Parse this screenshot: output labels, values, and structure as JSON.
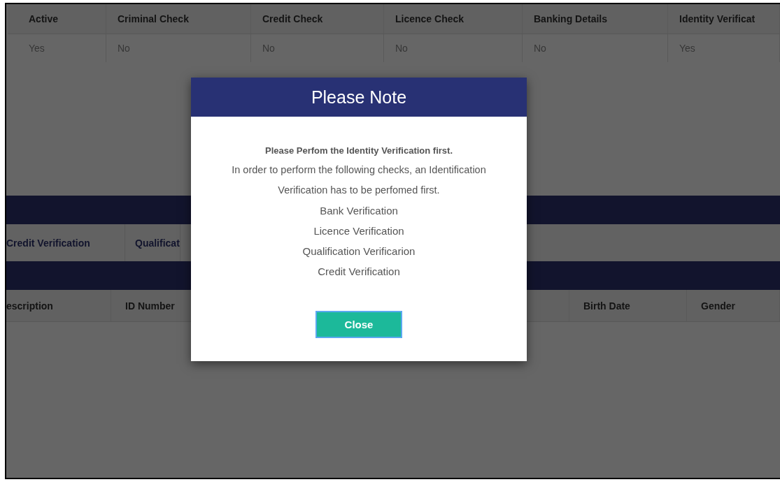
{
  "top_table": {
    "columns": [
      "Active",
      "Criminal Check",
      "Credit Check",
      "Licence Check",
      "Banking Details",
      "Identity Verificat"
    ],
    "rows": [
      [
        "Yes",
        "No",
        "No",
        "No",
        "No",
        "Yes"
      ]
    ]
  },
  "tabs": [
    {
      "label": "Credit Verification"
    },
    {
      "label": "Qualificat"
    }
  ],
  "bottom_table": {
    "columns": [
      "escription",
      "ID Number",
      "Birth Date",
      "Gender"
    ]
  },
  "dialog": {
    "title": "Please Note",
    "heading": "Please Perfom the Identity Verification first.",
    "message": "In order to perform the following checks, an Identification Verification has to be perfomed first.",
    "items": [
      "Bank Verification",
      "Licence Verification",
      "Qualification Verificarion",
      "Credit Verification"
    ],
    "button": "Close"
  }
}
